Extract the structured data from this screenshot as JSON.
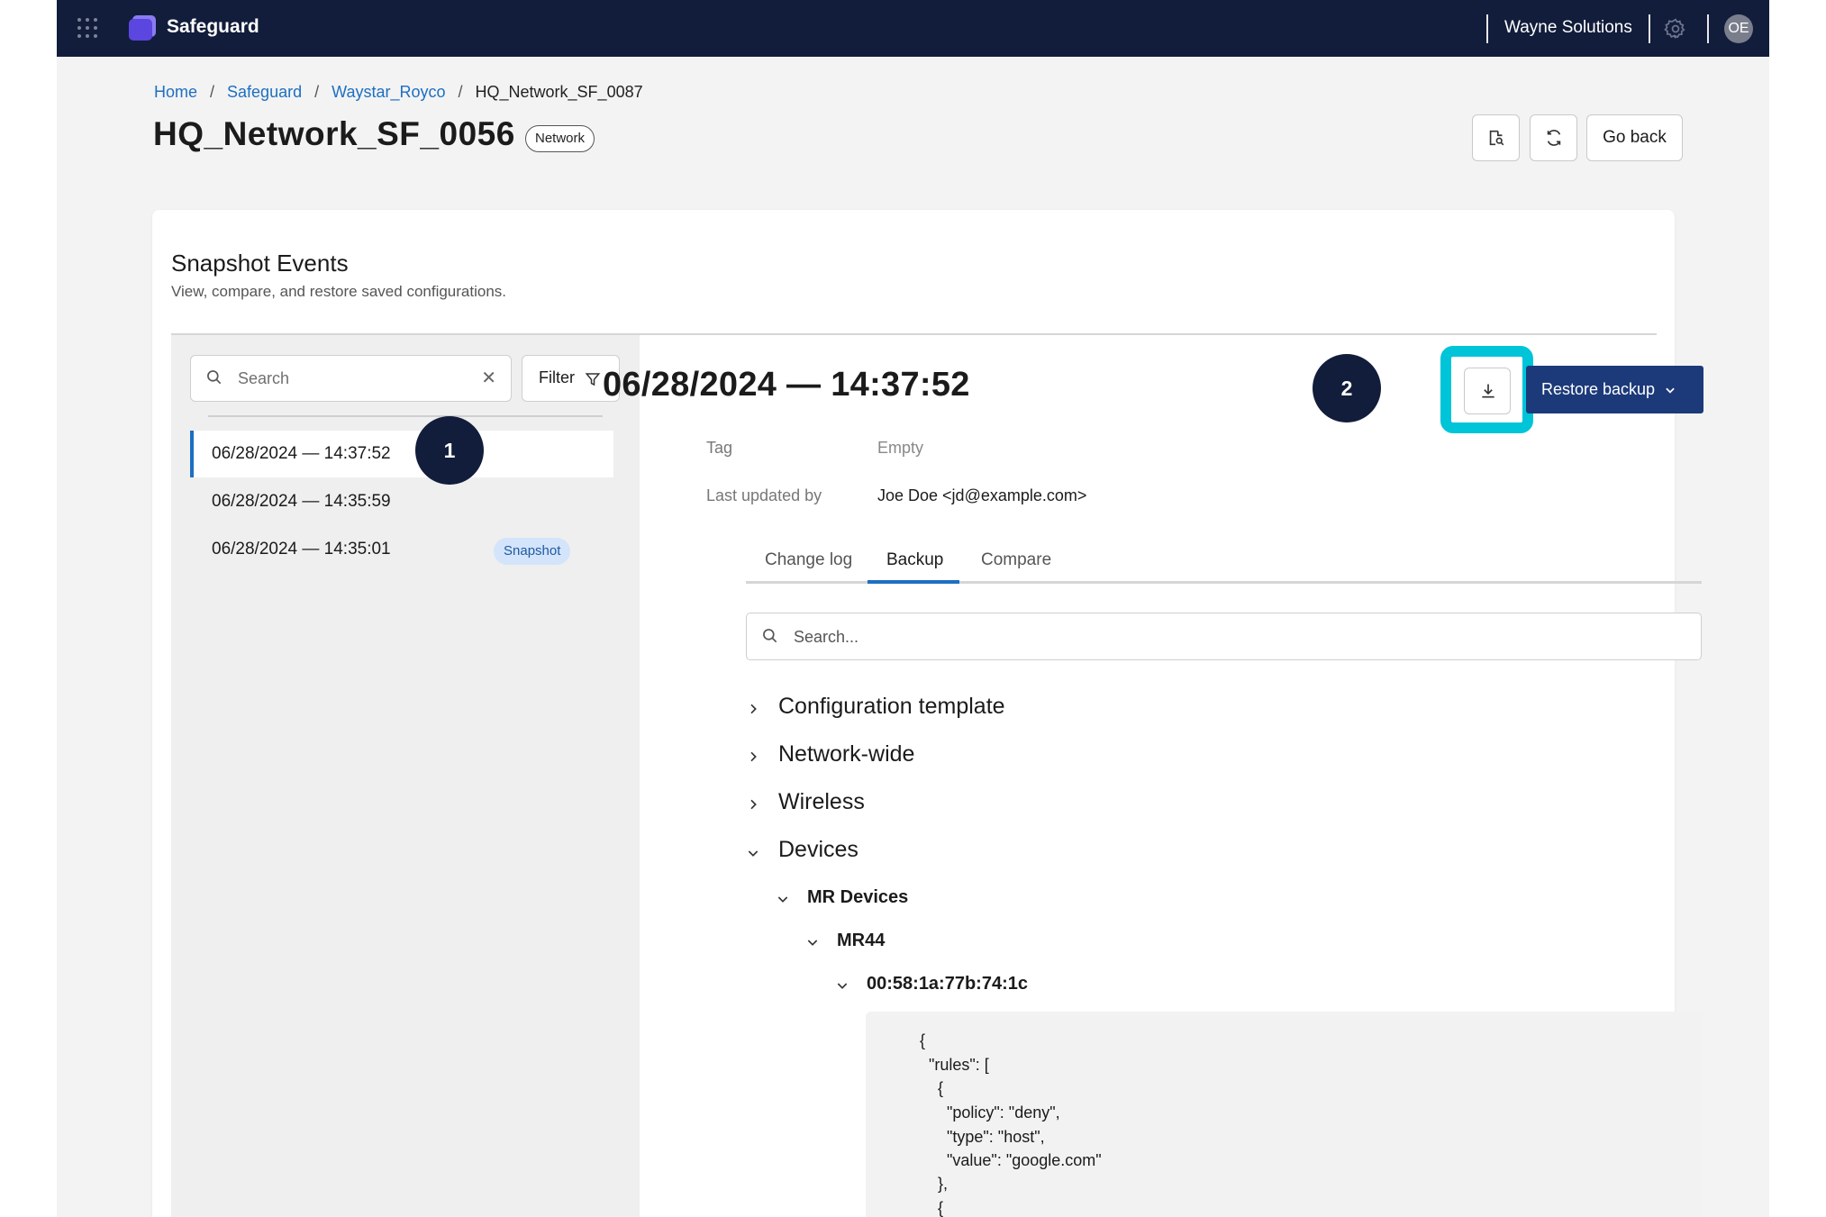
{
  "topbar": {
    "brand": "Safeguard",
    "org": "Wayne Solutions",
    "avatar_initials": "OE"
  },
  "breadcrumb": [
    {
      "label": "Home",
      "link": true
    },
    {
      "label": "Safeguard",
      "link": true
    },
    {
      "label": "Waystar_Royco",
      "link": true
    },
    {
      "label": "HQ_Network_SF_0087",
      "link": false
    }
  ],
  "header": {
    "title": "HQ_Network_SF_0056",
    "type_badge": "Network",
    "go_back_label": "Go back"
  },
  "card": {
    "title": "Snapshot Events",
    "subtitle": "View, compare, and restore saved configurations."
  },
  "list": {
    "search_placeholder": "Search",
    "filter_label": "Filter",
    "items": [
      {
        "label": "06/28/2024 — 14:37:52",
        "active": true,
        "badge": ""
      },
      {
        "label": "06/28/2024 — 14:35:59",
        "active": false,
        "badge": ""
      },
      {
        "label": "06/28/2024 — 14:35:01",
        "active": false,
        "badge": "Snapshot"
      }
    ]
  },
  "steps": {
    "one": "1",
    "two": "2"
  },
  "detail": {
    "title": "06/28/2024 — 14:37:52",
    "tag_label": "Tag",
    "tag_value": "Empty",
    "updated_label": "Last updated by",
    "updated_value": "Joe Doe <jd@example.com>",
    "restore_label": "Restore backup",
    "tabs": [
      {
        "label": "Change log",
        "active": false
      },
      {
        "label": "Backup",
        "active": true
      },
      {
        "label": "Compare",
        "active": false
      }
    ],
    "search_placeholder": "Search..."
  },
  "tree": {
    "sections": [
      {
        "label": "Configuration template",
        "expanded": false
      },
      {
        "label": "Network-wide",
        "expanded": false
      },
      {
        "label": "Wireless",
        "expanded": false
      },
      {
        "label": "Devices",
        "expanded": true
      }
    ],
    "mr_devices": "MR Devices",
    "mr44": "MR44",
    "mac": "00:58:1a:77b:74:1c"
  },
  "code": [
    "{",
    "  \"rules\": [",
    "    {",
    "      \"policy\": \"deny\",",
    "      \"type\": \"host\",",
    "      \"value\": \"google.com\"",
    "    },",
    "    {"
  ],
  "colors": {
    "topbar": "#121d3b",
    "accent": "#1d6fc2",
    "restore": "#1c3a7a",
    "highlight": "#00c4d8"
  }
}
